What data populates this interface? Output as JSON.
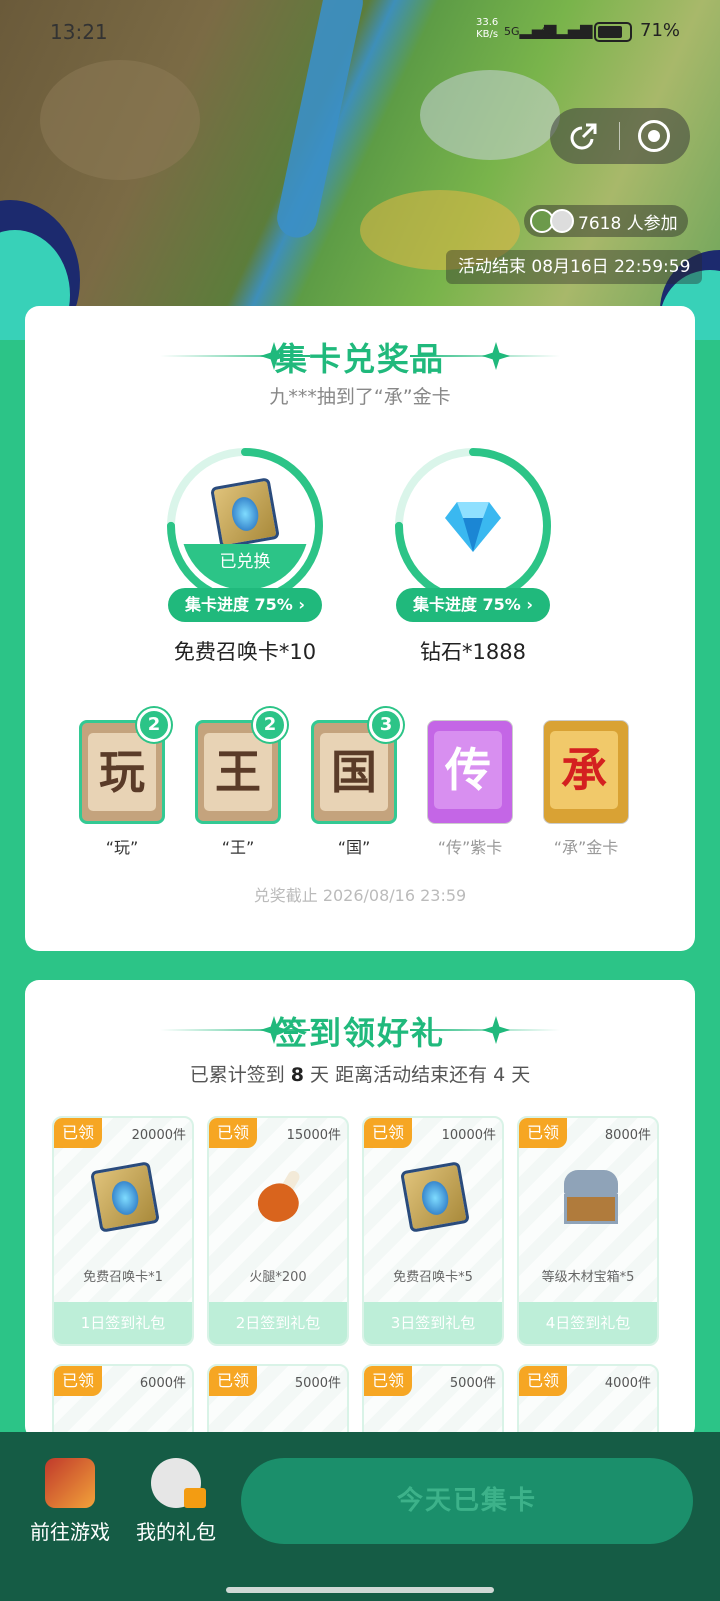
{
  "status_bar": {
    "time": "13:21",
    "net_speed": "33.6",
    "net_unit": "KB/s",
    "net_5g": "5G",
    "net_4g": "4G",
    "battery": "71%"
  },
  "hero": {
    "participants": "7618 人参加",
    "end_time": "活动结束 08月16日 22:59:59"
  },
  "collect": {
    "title": "集卡兑奖品",
    "subtitle": "九***抽到了“承”金卡",
    "prizes": [
      {
        "name": "免费召唤卡*10",
        "progress": "集卡进度 75%",
        "progress_value": 0.75,
        "status": "已兑换"
      },
      {
        "name": "钻石*1888",
        "progress": "集卡进度 75%",
        "progress_value": 0.75
      }
    ],
    "cards": [
      {
        "char": "玩",
        "label": "“玩”",
        "count": "2"
      },
      {
        "char": "王",
        "label": "“王”",
        "count": "2"
      },
      {
        "char": "国",
        "label": "“国”",
        "count": "3"
      },
      {
        "char": "传",
        "label": "“传”紫卡"
      },
      {
        "char": "承",
        "label": "“承”金卡"
      }
    ],
    "deadline": "兑奖截止 2026/08/16 23:59"
  },
  "signin": {
    "title": "签到领好礼",
    "summary_prefix": "已累计签到 ",
    "days_signed": "8",
    "summary_mid": " 天  距离活动结束还有 4 天",
    "gifts": [
      {
        "tag": "已领",
        "stock": "20000件",
        "name": "免费召唤卡*1",
        "day": "1日签到礼包",
        "icon": "summon-card-icon"
      },
      {
        "tag": "已领",
        "stock": "15000件",
        "name": "火腿*200",
        "day": "2日签到礼包",
        "icon": "ham-icon"
      },
      {
        "tag": "已领",
        "stock": "10000件",
        "name": "免费召唤卡*5",
        "day": "3日签到礼包",
        "icon": "summon-card-icon"
      },
      {
        "tag": "已领",
        "stock": "8000件",
        "name": "等级木材宝箱*5",
        "day": "4日签到礼包",
        "icon": "treasure-chest-icon"
      },
      {
        "tag": "已领",
        "stock": "6000件"
      },
      {
        "tag": "已领",
        "stock": "5000件"
      },
      {
        "tag": "已领",
        "stock": "5000件"
      },
      {
        "tag": "已领",
        "stock": "4000件"
      }
    ]
  },
  "bottom_bar": {
    "game_label": "前往游戏",
    "gift_label": "我的礼包",
    "main_button": "今天已集卡"
  },
  "colors": {
    "brand_green": "#2cc487",
    "dark_green": "#155c45",
    "tag_orange": "#f6a623"
  }
}
